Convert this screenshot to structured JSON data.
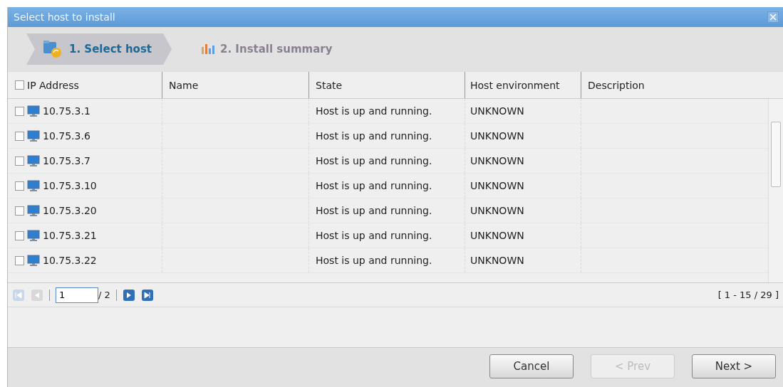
{
  "window": {
    "title": "Select host to install"
  },
  "steps": [
    {
      "label": "1. Select host",
      "selected": true
    },
    {
      "label": "2. Install summary",
      "selected": false
    }
  ],
  "table": {
    "select_all_checked": false,
    "columns": [
      "IP Address",
      "Name",
      "State",
      "Host environment",
      "Description"
    ],
    "rows": [
      {
        "checked": false,
        "ip": "10.75.3.1",
        "state": "Host is up and running.",
        "environment": "UNKNOWN"
      },
      {
        "checked": false,
        "ip": "10.75.3.6",
        "state": "Host is up and running.",
        "environment": "UNKNOWN"
      },
      {
        "checked": false,
        "ip": "10.75.3.7",
        "state": "Host is up and running.",
        "environment": "UNKNOWN"
      },
      {
        "checked": false,
        "ip": "10.75.3.10",
        "state": "Host is up and running.",
        "environment": "UNKNOWN"
      },
      {
        "checked": false,
        "ip": "10.75.3.20",
        "state": "Host is up and running.",
        "environment": "UNKNOWN"
      },
      {
        "checked": false,
        "ip": "10.75.3.21",
        "state": "Host is up and running.",
        "environment": "UNKNOWN"
      },
      {
        "checked": false,
        "ip": "10.75.3.22",
        "state": "Host is up and running.",
        "environment": "UNKNOWN"
      }
    ]
  },
  "pager": {
    "page": "1",
    "total": "/ 2",
    "range": "[ 1 - 15 / 29 ]"
  },
  "buttons": [
    {
      "label": "Cancel",
      "disabled": false
    },
    {
      "label": "< Prev",
      "disabled": true
    },
    {
      "label": "Next >",
      "disabled": false
    }
  ]
}
